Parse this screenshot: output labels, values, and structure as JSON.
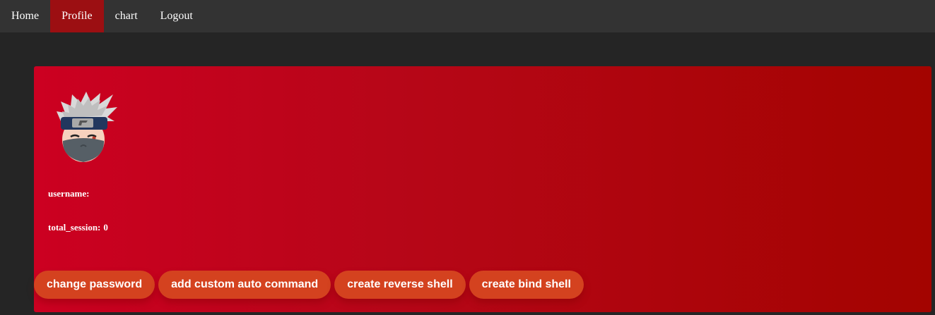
{
  "nav": {
    "items": [
      {
        "label": "Home",
        "active": false
      },
      {
        "label": "Profile",
        "active": true
      },
      {
        "label": "chart",
        "active": false
      },
      {
        "label": "Logout",
        "active": false
      }
    ]
  },
  "profile": {
    "avatar_icon": "ninja-avatar-icon",
    "username_label": "username:",
    "username_value": "",
    "total_session_label": "total_session:",
    "total_session_value": "0"
  },
  "actions": {
    "change_password": "change password",
    "add_custom_auto_command": "add custom auto command",
    "create_reverse_shell": "create reverse shell",
    "create_bind_shell": "create bind shell"
  },
  "colors": {
    "navbar_bg": "#333333",
    "nav_active_bg": "#9c0f12",
    "page_bg": "#252525",
    "card_gradient_start": "#cc0021",
    "card_gradient_end": "#a30400",
    "button_bg": "#d4421f"
  }
}
